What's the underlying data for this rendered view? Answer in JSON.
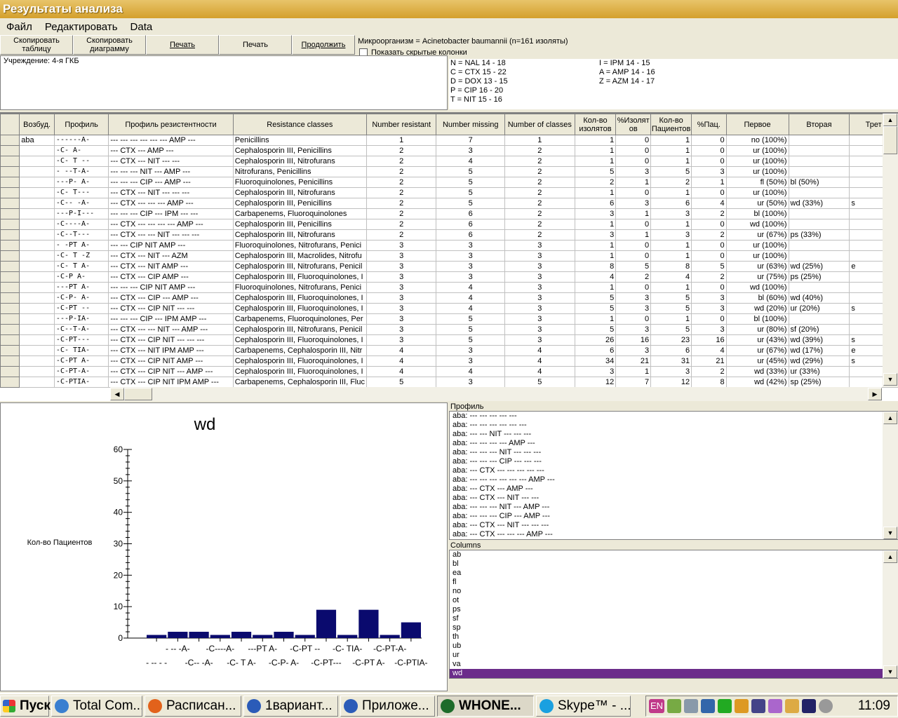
{
  "window": {
    "title": "Результаты анализа"
  },
  "menu": [
    "Файл",
    "Редактировать",
    "Data"
  ],
  "toolbar": {
    "copy_table": "Скопировать таблицу",
    "copy_chart": "Скопировать диаграмму",
    "print1": "Печать",
    "print2": "Печать",
    "continue": "Продолжить"
  },
  "micro": {
    "label": "Микроорганизм = Acinetobacter baumannii   (n=161 изоляты)",
    "show_hidden": "Показать скрытые колонки"
  },
  "institution": {
    "label": "Учреждение:  4-я ГКБ"
  },
  "codes": [
    [
      "N = NAL 14 - 18",
      "I = IPM 14 - 15"
    ],
    [
      "C = CTX 15 - 22",
      "A = AMP 14 - 16"
    ],
    [
      "D = DOX 13 - 15",
      "Z = AZM 14 - 17"
    ],
    [
      "P = CIP 16 - 20",
      ""
    ],
    [
      "T = NIT 15 - 16",
      ""
    ]
  ],
  "grid": {
    "headers": [
      "Возбуд.",
      "Профиль",
      "Профиль резистентности",
      "Resistance classes",
      "Number resistant",
      "Number missing",
      "Number of classes",
      "Кол-во изолятов",
      "%Изолят ов",
      "Кол-во Пациентов",
      "%Пац.",
      "Первое",
      "Вторая",
      "Трет"
    ],
    "organism": "aba",
    "rows": [
      [
        "------A-",
        "--- --- --- --- --- --- AMP ---",
        "Penicillins",
        "1",
        "7",
        "1",
        "1",
        "0",
        "1",
        "0",
        "no (100%)",
        "",
        ""
      ],
      [
        "-C-    A-",
        "--- CTX ---           AMP ---",
        "Cephalosporin III, Penicillins",
        "2",
        "3",
        "2",
        "1",
        "0",
        "1",
        "0",
        "ur (100%)",
        "",
        ""
      ],
      [
        "-C-  T --",
        "--- CTX ---     NIT    --- ---",
        "Cephalosporin III, Nitrofurans",
        "2",
        "4",
        "2",
        "1",
        "0",
        "1",
        "0",
        "ur (100%)",
        "",
        ""
      ],
      [
        "-  --T-A-",
        "---    --- --- NIT --- AMP ---",
        "Nitrofurans, Penicillins",
        "2",
        "5",
        "2",
        "5",
        "3",
        "5",
        "3",
        "ur (100%)",
        "",
        ""
      ],
      [
        "---P-  A-",
        "--- --- --- CIP ---     AMP ---",
        "Fluoroquinolones, Penicillins",
        "2",
        "5",
        "2",
        "2",
        "1",
        "2",
        "1",
        "fl (50%)",
        "bl (50%)",
        ""
      ],
      [
        "-C-  T---",
        "--- CTX ---     NIT --- --- ---",
        "Cephalosporin III, Nitrofurans",
        "2",
        "5",
        "2",
        "1",
        "0",
        "1",
        "0",
        "ur (100%)",
        "",
        ""
      ],
      [
        "-C--  -A-",
        "--- CTX --- ---     --- AMP ---",
        "Cephalosporin III, Penicillins",
        "2",
        "5",
        "2",
        "6",
        "3",
        "6",
        "4",
        "ur (50%)",
        "wd (33%)",
        "s"
      ],
      [
        "---P-I---",
        "--- --- --- CIP --- IPM --- ---",
        "Carbapenems, Fluoroquinolones",
        "2",
        "6",
        "2",
        "3",
        "1",
        "3",
        "2",
        "bl (100%)",
        "",
        ""
      ],
      [
        "-C----A-",
        "--- CTX --- --- --- --- AMP ---",
        "Cephalosporin III, Penicillins",
        "2",
        "6",
        "2",
        "1",
        "0",
        "1",
        "0",
        "wd (100%)",
        "",
        ""
      ],
      [
        "-C--T---",
        "--- CTX --- --- NIT --- --- ---",
        "Cephalosporin III, Nitrofurans",
        "2",
        "6",
        "2",
        "3",
        "1",
        "3",
        "2",
        "ur (67%)",
        "ps (33%)",
        ""
      ],
      [
        "-  -PT A-",
        "---    --- CIP NIT     AMP ---",
        "Fluoroquinolones, Nitrofurans, Penici",
        "3",
        "3",
        "3",
        "1",
        "0",
        "1",
        "0",
        "ur (100%)",
        "",
        ""
      ],
      [
        "-C-  T -Z",
        "--- CTX ---     NIT     --- AZM",
        "Cephalosporin III, Macrolides, Nitrofu",
        "3",
        "3",
        "3",
        "1",
        "0",
        "1",
        "0",
        "ur (100%)",
        "",
        ""
      ],
      [
        "-C-  T  A-",
        "--- CTX ---     NIT     AMP ---",
        "Cephalosporin III, Nitrofurans, Penicil",
        "3",
        "3",
        "3",
        "8",
        "5",
        "8",
        "5",
        "ur (63%)",
        "wd (25%)",
        "e"
      ],
      [
        "-C-P   A-",
        "--- CTX --- CIP         AMP ---",
        "Cephalosporin III, Fluoroquinolones, I",
        "3",
        "3",
        "3",
        "4",
        "2",
        "4",
        "2",
        "ur (75%)",
        "ps (25%)",
        ""
      ],
      [
        "---PT  A-",
        "--- --- --- CIP NIT     AMP ---",
        "Fluoroquinolones, Nitrofurans, Penici",
        "3",
        "4",
        "3",
        "1",
        "0",
        "1",
        "0",
        "wd (100%)",
        "",
        ""
      ],
      [
        "-C-P-  A-",
        "--- CTX --- CIP ---     AMP ---",
        "Cephalosporin III, Fluoroquinolones, I",
        "3",
        "4",
        "3",
        "5",
        "3",
        "5",
        "3",
        "bl (60%)",
        "wd (40%)",
        ""
      ],
      [
        "-C-PT --",
        "--- CTX --- CIP NIT     --- ---",
        "Cephalosporin III, Fluoroquinolones, I",
        "3",
        "4",
        "3",
        "5",
        "3",
        "5",
        "3",
        "wd (20%)",
        "ur (20%)",
        "s"
      ],
      [
        "---P-IA-",
        "--- --- --- CIP --- IPM AMP ---",
        "Carbapenems, Fluoroquinolones, Per",
        "3",
        "5",
        "3",
        "1",
        "0",
        "1",
        "0",
        "bl (100%)",
        "",
        ""
      ],
      [
        "-C--T-A-",
        "--- CTX --- --- NIT --- AMP ---",
        "Cephalosporin III, Nitrofurans, Penicil",
        "3",
        "5",
        "3",
        "5",
        "3",
        "5",
        "3",
        "ur (80%)",
        "sf (20%)",
        ""
      ],
      [
        "-C-PT---",
        "--- CTX --- CIP NIT --- --- ---",
        "Cephalosporin III, Fluoroquinolones, I",
        "3",
        "5",
        "3",
        "26",
        "16",
        "23",
        "16",
        "ur (43%)",
        "wd (39%)",
        "s"
      ],
      [
        "-C-  TIA-",
        "--- CTX ---     NIT IPM AMP ---",
        "Carbapenems, Cephalosporin III, Nitr",
        "4",
        "3",
        "4",
        "6",
        "3",
        "6",
        "4",
        "ur (67%)",
        "wd (17%)",
        "e"
      ],
      [
        "-C-PT A-",
        "--- CTX --- CIP NIT     AMP ---",
        "Cephalosporin III, Fluoroquinolones, I",
        "4",
        "3",
        "4",
        "34",
        "21",
        "31",
        "21",
        "ur (45%)",
        "wd (29%)",
        "s"
      ],
      [
        "-C-PT-A-",
        "--- CTX --- CIP NIT --- AMP ---",
        "Cephalosporin III, Fluoroquinolones, I",
        "4",
        "4",
        "4",
        "3",
        "1",
        "3",
        "2",
        "wd (33%)",
        "ur (33%)",
        ""
      ],
      [
        "-C-PTIA-",
        "--- CTX --- CIP NIT IPM AMP ---",
        "Carbapenems, Cephalosporin III, Fluc",
        "5",
        "3",
        "5",
        "12",
        "7",
        "12",
        "8",
        "wd (42%)",
        "sp (25%)",
        ""
      ]
    ]
  },
  "chart_data": {
    "type": "bar",
    "title": "wd",
    "ylabel": "Кол-во Пациентов",
    "ylim": [
      0,
      60
    ],
    "yticks": [
      "0",
      "10",
      "20",
      "30",
      "40",
      "50",
      "60"
    ],
    "categories": [
      "- -- - -",
      "- -- -A-",
      "-C-- -A-",
      "-C----A-",
      "-C- T A-",
      "---PT A-",
      "-C-P- A-",
      "-C-PT --",
      "-C-PT---",
      "-C- TIA-",
      "-C-PT A-",
      "-C-PT-A-",
      "-C-PTIA-"
    ],
    "values": [
      1,
      2,
      2,
      1,
      2,
      1,
      2,
      1,
      9,
      1,
      9,
      1,
      5
    ],
    "color": "#0a0a6e"
  },
  "profile_panel": {
    "title": "Профиль",
    "items": [
      "aba: ---       --- ---      ---      ---",
      "aba: ---       --- ---      --- --- ---",
      "aba: ---       ---      NIT --- --- ---",
      "aba: ---       --- ---      --- AMP ---",
      "aba: ---       --- --- NIT --- --- ---",
      "aba: --- --- --- CIP ---       --- ---",
      "aba: --- CTX --- ---       --- --- ---",
      "aba: --- --- --- --- --- --- AMP ---",
      "aba: --- CTX ---           AMP ---",
      "aba: --- CTX ---      NIT      --- ---",
      "aba: ---       --- --- NIT --- AMP ---",
      "aba: --- --- --- CIP ---      AMP ---",
      "aba: --- CTX ---      NIT --- --- ---",
      "aba: --- CTX --- ---      --- AMP ---"
    ]
  },
  "columns_panel": {
    "title": "Columns",
    "items": [
      "ab",
      "bl",
      "ea",
      "fl",
      "no",
      "ot",
      "ps",
      "sf",
      "sp",
      "th",
      "ub",
      "ur",
      "va",
      "wd"
    ],
    "selected": "wd",
    "selected_color": "#6b2c8a"
  },
  "taskbar": {
    "start": "Пуск",
    "items": [
      {
        "label": "Total Com...",
        "icon": "total-commander-icon"
      },
      {
        "label": "Расписан...",
        "icon": "firefox-icon"
      },
      {
        "label": "1вариант...",
        "icon": "word-icon"
      },
      {
        "label": "Приложе...",
        "icon": "word-icon"
      },
      {
        "label": "WHONE...",
        "icon": "whonet-icon"
      },
      {
        "label": "Skype™ - ...",
        "icon": "skype-icon"
      }
    ],
    "lang": "EN",
    "clock": "11:09"
  }
}
